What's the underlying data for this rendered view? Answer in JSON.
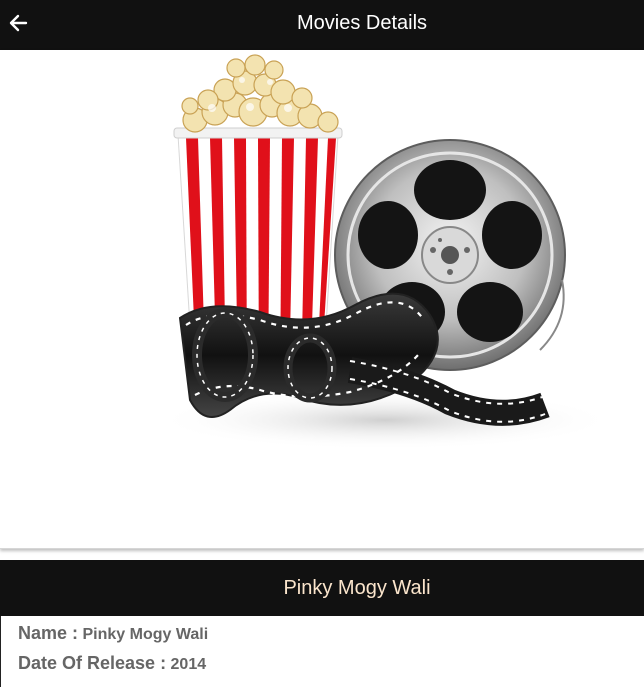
{
  "app_bar": {
    "title": "Movies Details",
    "back_icon": "arrow-left-icon"
  },
  "hero": {
    "image": "popcorn-film-reel-illustration"
  },
  "movie": {
    "title": "Pinky Mogy Wali",
    "name_label": "Name :",
    "name_value": "Pinky Mogy Wali",
    "release_label": "Date Of Release :",
    "release_value": "2014"
  },
  "colors": {
    "bar_bg": "#111111",
    "title_text": "#fbe5cc",
    "detail_text": "#666666",
    "popcorn_stripe": "#e0101a"
  }
}
